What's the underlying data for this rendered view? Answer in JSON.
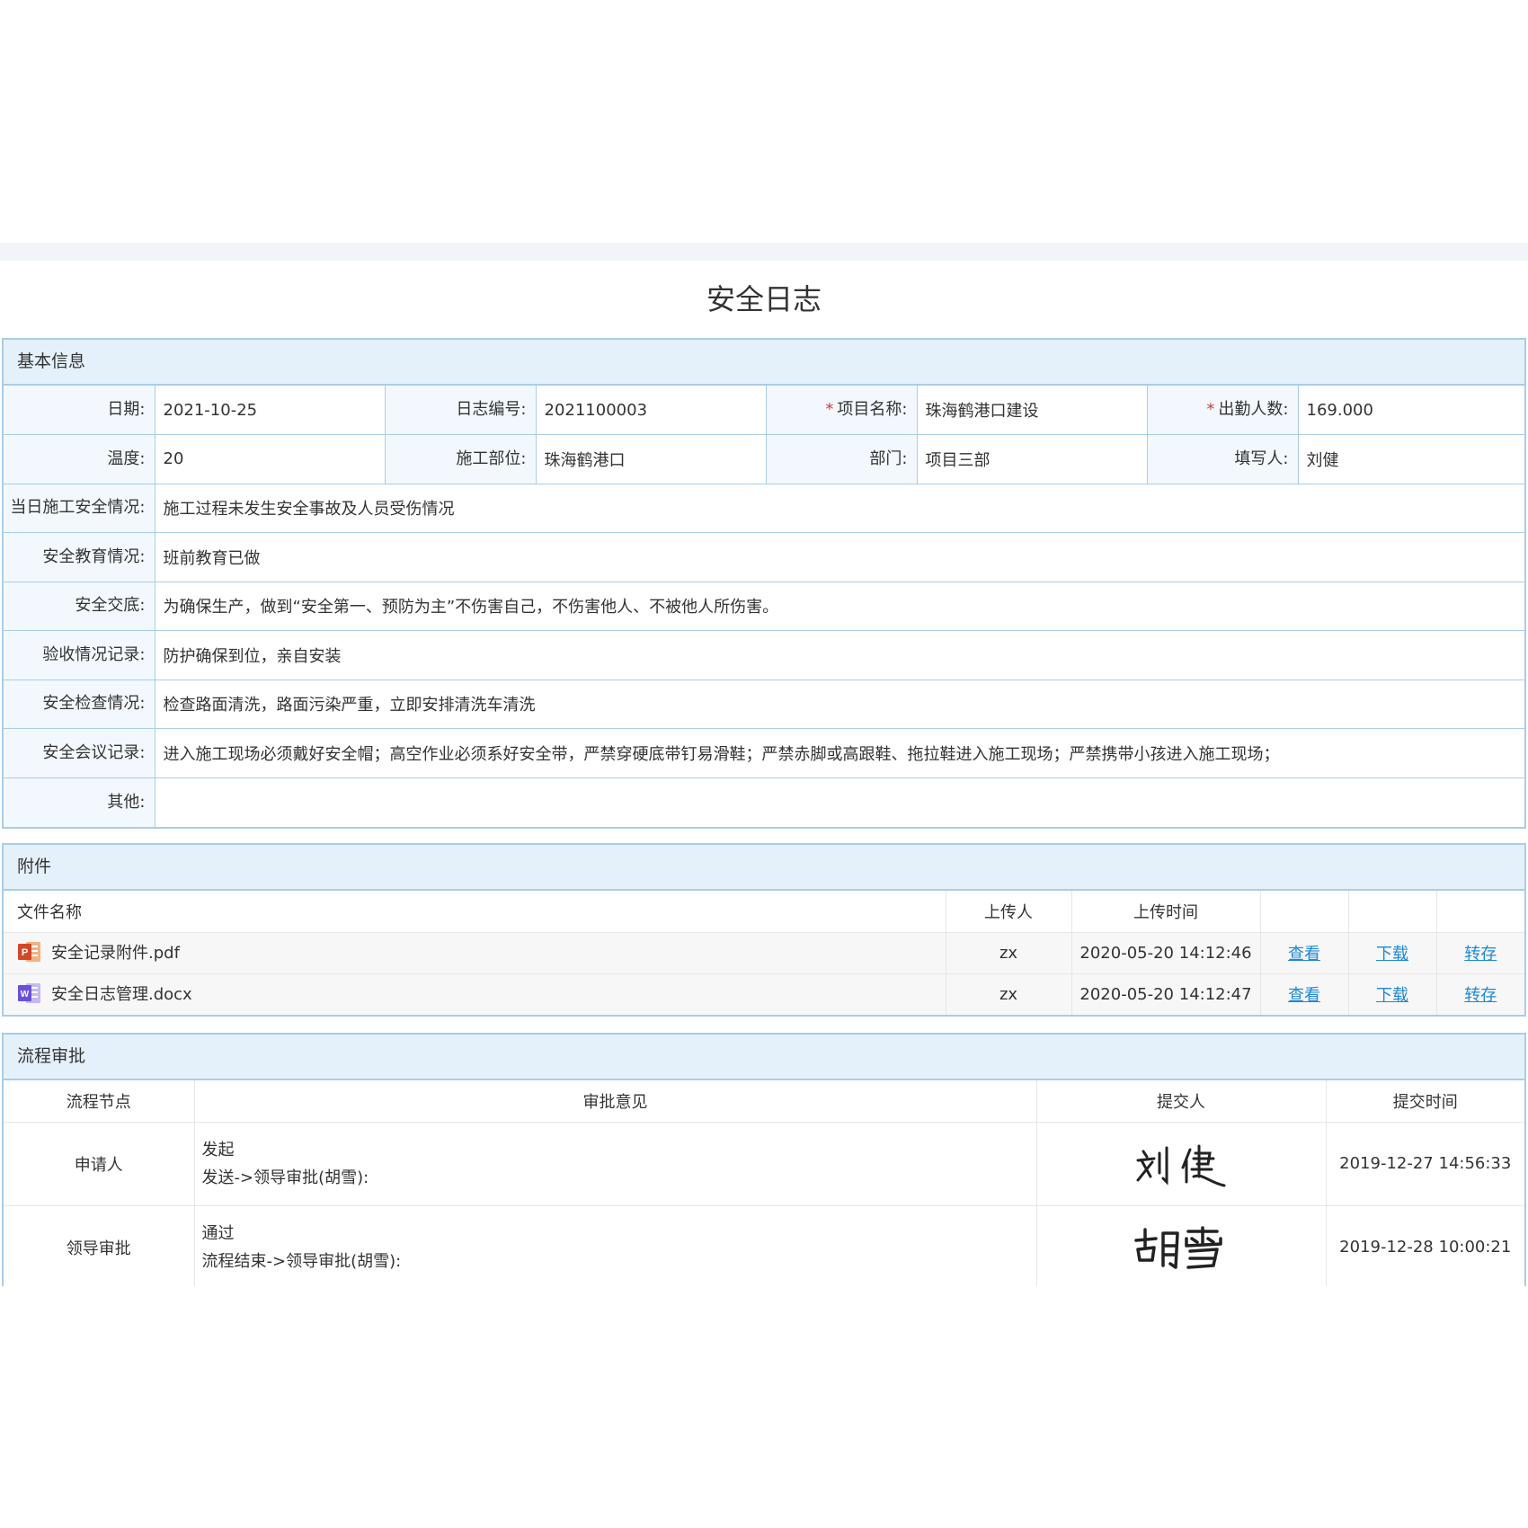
{
  "page_title": "安全日志",
  "basic": {
    "header": "基本信息",
    "row1": [
      {
        "label": "日期:",
        "value": "2021-10-25",
        "required": false
      },
      {
        "label": "日志编号:",
        "value": "2021100003",
        "required": false
      },
      {
        "label": "项目名称:",
        "value": "珠海鹤港口建设",
        "required": true
      },
      {
        "label": "出勤人数:",
        "value": "169.000",
        "required": true
      }
    ],
    "row2": [
      {
        "label": "温度:",
        "value": "20"
      },
      {
        "label": "施工部位:",
        "value": "珠海鹤港口"
      },
      {
        "label": "部门:",
        "value": "项目三部"
      },
      {
        "label": "填写人:",
        "value": "刘健"
      }
    ],
    "wide_rows": [
      {
        "label": "当日施工安全情况:",
        "value": "施工过程未发生安全事故及人员受伤情况"
      },
      {
        "label": "安全教育情况:",
        "value": "班前教育已做"
      },
      {
        "label": "安全交底:",
        "value": "为确保生产，做到“安全第一、预防为主”不伤害自己，不伤害他人、不被他人所伤害。"
      },
      {
        "label": "验收情况记录:",
        "value": "防护确保到位，亲自安装"
      },
      {
        "label": "安全检查情况:",
        "value": "检查路面清洗，路面污染严重，立即安排清洗车清洗"
      },
      {
        "label": "安全会议记录:",
        "value": "进入施工现场必须戴好安全帽；高空作业必须系好安全带，严禁穿硬底带钉易滑鞋；严禁赤脚或高跟鞋、拖拉鞋进入施工现场；严禁携带小孩进入施工现场；"
      },
      {
        "label": "其他:",
        "value": ""
      }
    ],
    "required_mark": "*"
  },
  "attachments": {
    "header": "附件",
    "columns": [
      "文件名称",
      "上传人",
      "上传时间"
    ],
    "files": [
      {
        "name": "安全记录附件.pdf",
        "icon": "powerpoint-file-icon",
        "icon_letter": "P",
        "uploader": "zx",
        "time": "2020-05-20 14:12:46",
        "view": "查看",
        "download": "下载",
        "save": "转存"
      },
      {
        "name": "安全日志管理.docx",
        "icon": "word-file-icon",
        "icon_letter": "W",
        "uploader": "zx",
        "time": "2020-05-20 14:12:47",
        "view": "查看",
        "download": "下载",
        "save": "转存"
      }
    ]
  },
  "approval": {
    "header": "流程审批",
    "columns": [
      "流程节点",
      "审批意见",
      "提交人",
      "提交时间"
    ],
    "rows": [
      {
        "node": "申请人",
        "opinion": "发起",
        "flow": "发送->领导审批(胡雪):",
        "signature": "刘健",
        "time": "2019-12-27 14:56:33"
      },
      {
        "node": "领导审批",
        "opinion": "通过",
        "flow": "流程结束->领导审批(胡雪):",
        "signature": "胡雪",
        "time": "2019-12-28 10:00:21"
      }
    ]
  },
  "colors": {
    "border": "#a9cde8",
    "header_bg": "#e4f1fb",
    "link": "#1e88d6",
    "required": "#d23c3c",
    "ppt_icon": "#d24726",
    "word_icon": "#6b4fd8"
  }
}
